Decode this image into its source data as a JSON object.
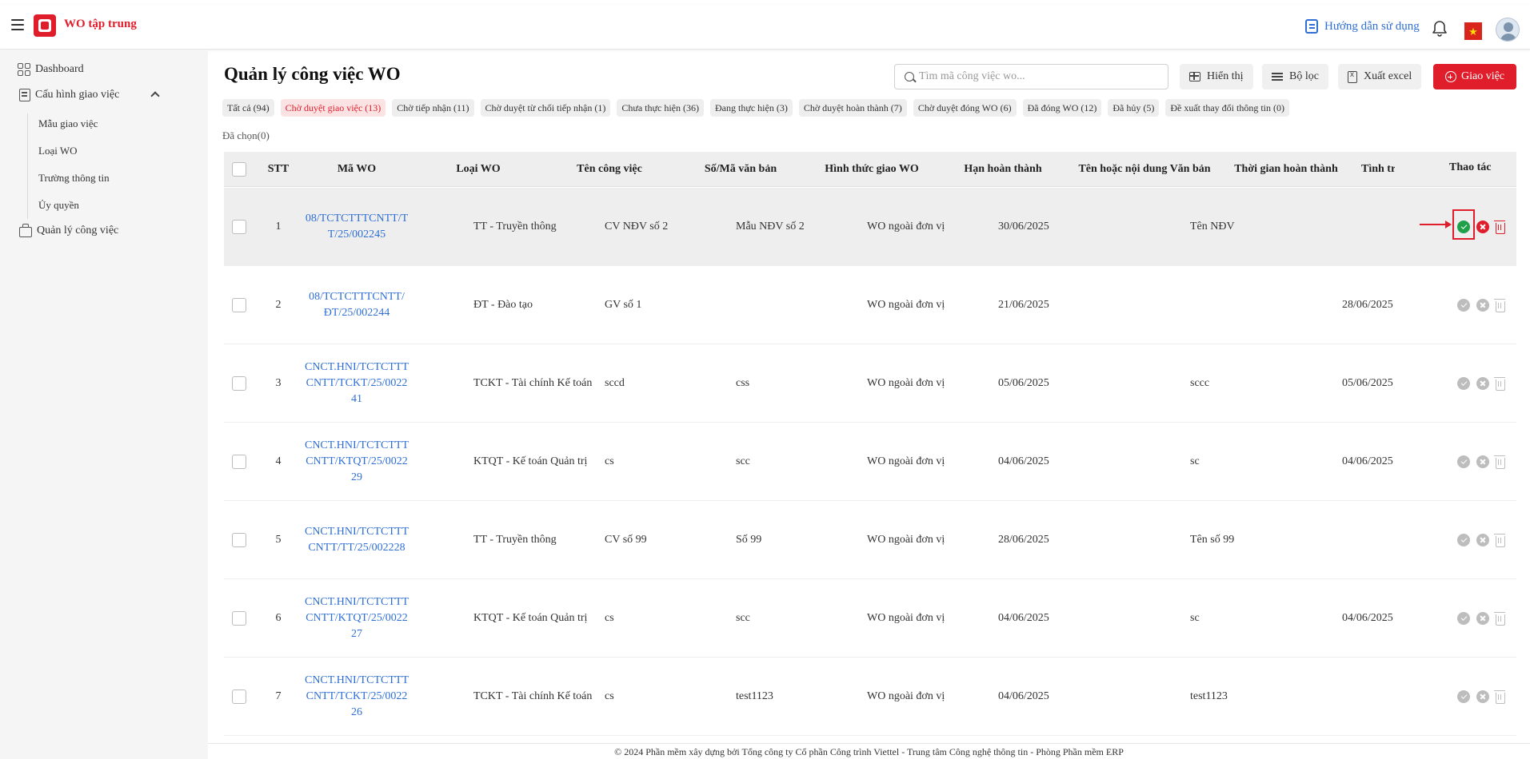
{
  "header": {
    "app_title": "WO tập trung",
    "guide_label": "Hướng dẫn sử dụng"
  },
  "sidebar": {
    "dashboard": "Dashboard",
    "config": "Cấu hình giao việc",
    "sub_items": [
      "Mẫu giao việc",
      "Loại WO",
      "Trường thông tin",
      "Ủy quyền"
    ],
    "manage": "Quản lý công việc"
  },
  "page": {
    "title": "Quản lý công việc WO",
    "search_placeholder": "Tìm mã công việc wo...",
    "btn_display": "Hiển thị",
    "btn_filter": "Bộ lọc",
    "btn_excel": "Xuất excel",
    "btn_assign": "Giao việc",
    "selected_label": "Đã chọn(0)"
  },
  "chips": [
    "Tất cả (94)",
    "Chờ duyệt giao việc (13)",
    "Chờ tiếp nhận (11)",
    "Chờ duyệt từ chối tiếp nhận (1)",
    "Chưa thực hiện (36)",
    "Đang thực hiện (3)",
    "Chờ duyệt hoàn thành (7)",
    "Chờ duyệt đóng WO (6)",
    "Đã đóng WO (12)",
    "Đã hủy (5)",
    "Đề xuất thay đổi thông tin (0)"
  ],
  "active_chip": 1,
  "table": {
    "headers": [
      "STT",
      "Mã WO",
      "Loại WO",
      "Tên công việc",
      "Số/Mã văn bản",
      "Hình thức giao WO",
      "Hạn hoàn thành",
      "Tên hoặc nội dung Văn bản",
      "Thời gian hoàn thành",
      "Tình tr",
      "Thao tác"
    ],
    "rows": [
      {
        "stt": "1",
        "ma_wo": "08/TCTCTTTCNTT/TT/25/002245",
        "loai": "TT - Truyền thông",
        "ten": "CV NĐV số 2",
        "so": "Mẫu NĐV số 2",
        "hinh_thuc": "WO ngoài đơn vị",
        "han": "30/06/2025",
        "noi_dung": "Tên NĐV",
        "thoi_gian": ""
      },
      {
        "stt": "2",
        "ma_wo": "08/TCTCTTTCNTT/ ĐT/25/002244",
        "loai": "ĐT - Đào tạo",
        "ten": "GV số 1",
        "so": "",
        "hinh_thuc": "WO ngoài đơn vị",
        "han": "21/06/2025",
        "noi_dung": "",
        "thoi_gian": "28/06/2025"
      },
      {
        "stt": "3",
        "ma_wo": "CNCT.HNI/TCTCTTTCNTT/TCKT/25/002241",
        "loai": "TCKT - Tài chính Kế toán",
        "ten": "sccd",
        "so": "css",
        "hinh_thuc": "WO ngoài đơn vị",
        "han": "05/06/2025",
        "noi_dung": "sccc",
        "thoi_gian": "05/06/2025"
      },
      {
        "stt": "4",
        "ma_wo": "CNCT.HNI/TCTCTTTCNTT/KTQT/25/002229",
        "loai": "KTQT - Kế toán Quản trị",
        "ten": "cs",
        "so": "scc",
        "hinh_thuc": "WO ngoài đơn vị",
        "han": "04/06/2025",
        "noi_dung": "sc",
        "thoi_gian": "04/06/2025"
      },
      {
        "stt": "5",
        "ma_wo": "CNCT.HNI/TCTCTTTCNTT/TT/25/002228",
        "loai": "TT - Truyền thông",
        "ten": "CV số 99",
        "so": "Số 99",
        "hinh_thuc": "WO ngoài đơn vị",
        "han": "28/06/2025",
        "noi_dung": "Tên số 99",
        "thoi_gian": ""
      },
      {
        "stt": "6",
        "ma_wo": "CNCT.HNI/TCTCTTTCNTT/KTQT/25/002227",
        "loai": "KTQT - Kế toán Quản trị",
        "ten": "cs",
        "so": "scc",
        "hinh_thuc": "WO ngoài đơn vị",
        "han": "04/06/2025",
        "noi_dung": "sc",
        "thoi_gian": "04/06/2025"
      },
      {
        "stt": "7",
        "ma_wo": "CNCT.HNI/TCTCTTTCNTT/TCKT/25/002226",
        "loai": "TCKT - Tài chính Kế toán",
        "ten": "cs",
        "so": "test1123",
        "hinh_thuc": "WO ngoài đơn vị",
        "han": "04/06/2025",
        "noi_dung": "test1123",
        "thoi_gian": ""
      }
    ]
  },
  "footer": "© 2024 Phần mềm xây dựng bởi Tổng công ty Cổ phần Công trình Viettel - Trung tâm Công nghệ thông tin - Phòng Phần mềm ERP",
  "colors": {
    "brand": "#e01e2b",
    "link": "#2f6fd6",
    "approve_active": "#20a04a"
  },
  "icons": [
    "menu-icon",
    "logo-icon",
    "guide-icon",
    "bell-icon",
    "vn-flag-icon",
    "avatar",
    "dashboard-icon",
    "config-icon",
    "briefcase-icon",
    "search-icon",
    "table-icon",
    "filter-icon",
    "excel-icon",
    "plus-circle-icon",
    "approve-icon",
    "reject-icon",
    "delete-icon"
  ]
}
